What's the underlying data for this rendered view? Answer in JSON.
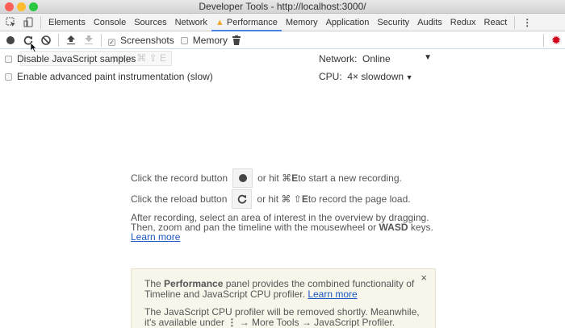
{
  "window": {
    "title": "Developer Tools - http://localhost:3000/"
  },
  "tabs": [
    {
      "label": "Elements"
    },
    {
      "label": "Console"
    },
    {
      "label": "Sources"
    },
    {
      "label": "Network"
    },
    {
      "label": "Performance",
      "active": true,
      "warning": true
    },
    {
      "label": "Memory"
    },
    {
      "label": "Application"
    },
    {
      "label": "Security"
    },
    {
      "label": "Audits"
    },
    {
      "label": "Redux"
    },
    {
      "label": "React"
    }
  ],
  "toolbar": {
    "screenshots": {
      "label": "Screenshots",
      "checked": true
    },
    "memory": {
      "label": "Memory",
      "checked": false
    }
  },
  "tooltip": {
    "text": "page ⌘ ⇧ E"
  },
  "settings": {
    "disable_js": "Disable JavaScript samples",
    "paint": "Enable advanced paint instrumentation (slow)",
    "network_label": "Network:",
    "network_value": "Online",
    "cpu_label": "CPU:",
    "cpu_value": "4× slowdown"
  },
  "landing": {
    "record_pre": "Click the record button",
    "record_post_a": "or hit ⌘ ",
    "record_key": "E",
    "record_post_b": " to start a new recording.",
    "reload_pre": "Click the reload button",
    "reload_post_a": "or hit ⌘ ⇧ ",
    "reload_key": "E",
    "reload_post_b": " to record the page load.",
    "after1": "After recording, select an area of interest in the overview by dragging.",
    "after2a": "Then, zoom and pan the timeline with the mousewheel or ",
    "after2b": "WASD",
    "after2c": " keys.",
    "learn_more": "Learn more"
  },
  "notice": {
    "p1a": "The ",
    "p1b": "Performance",
    "p1c": " panel provides the combined functionality of Timeline and JavaScript CPU profiler. ",
    "p1link": "Learn more",
    "p2a": "The JavaScript CPU profiler will be removed shortly. Meanwhile, it's available under ",
    "p2b": "⋮",
    "p2c": " → More Tools → JavaScript Profiler.",
    "close": "×"
  },
  "colors": {
    "accent": "#4a84e0",
    "settings_gear": "#d0021b",
    "warning": "#f0a92b"
  }
}
